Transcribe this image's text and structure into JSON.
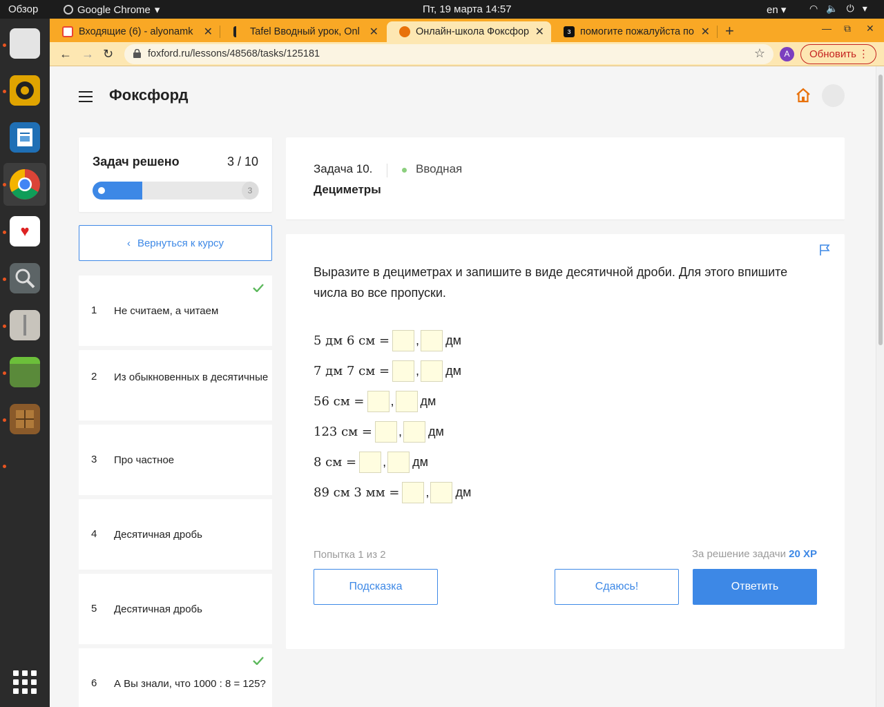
{
  "topbar": {
    "overview": "Обзор",
    "app_name": "Google Chrome",
    "clock": "Пт, 19 марта  14:57",
    "lang": "en"
  },
  "browser": {
    "tabs": [
      {
        "title": "Входящие (6) - alyonamk",
        "favicon_color": "#ea4335"
      },
      {
        "title": "Tafel Вводный урок, Onl",
        "favicon_color": "#222222"
      },
      {
        "title": "Онлайн-школа Фоксфор",
        "favicon_color": "#e8710a"
      },
      {
        "title": "помогите пожалуйста по",
        "favicon_color": "#111111"
      }
    ],
    "url": "foxford.ru/lessons/48568/tasks/125181",
    "profile_initial": "A",
    "update_label": "Обновить"
  },
  "page": {
    "logo": "Фоксфорд",
    "progress": {
      "label": "Задач решено",
      "count": "3 / 10",
      "fraction": 0.3,
      "end_number": "3"
    },
    "back_label": "Вернуться к курсу",
    "tasks": [
      {
        "num": "1",
        "title": "Не считаем, а читаем",
        "solved": true
      },
      {
        "num": "2",
        "title": "Из обыкновенных в десятичные",
        "solved": false
      },
      {
        "num": "3",
        "title": "Про частное",
        "solved": false
      },
      {
        "num": "4",
        "title": "Десятичная дробь",
        "solved": false
      },
      {
        "num": "5",
        "title": "Десятичная дробь",
        "solved": false
      },
      {
        "num": "6",
        "title": "А Вы знали, что 1000 : 8 = 125?",
        "solved": true
      }
    ],
    "task_header": {
      "number": "Задача 10.",
      "difficulty": "Вводная",
      "name": "Дециметры"
    },
    "question": "Выразите в дециметрах и запишите в виде десятичной дроби. Для этого впишите числа во все пропуски.",
    "equations": [
      {
        "lhs": "5 дм 6 см =",
        "unit": "дм"
      },
      {
        "lhs": "7 дм 7 см =",
        "unit": "дм"
      },
      {
        "lhs": "56 см =",
        "unit": "дм"
      },
      {
        "lhs": "123 см =",
        "unit": "дм"
      },
      {
        "lhs": "8 см =",
        "unit": "дм"
      },
      {
        "lhs": "89 см 3 мм =",
        "unit": "дм"
      }
    ],
    "comma": ",",
    "attempt": "Попытка 1 из 2",
    "reward_label": "За решение задачи",
    "reward_xp": "20 XP",
    "hint_label": "Подсказка",
    "giveup_label": "Сдаюсь!",
    "answer_label": "Ответить"
  },
  "colors": {
    "accent": "#3d88e6",
    "tabstrip": "#f9a825",
    "success": "#5cb85c",
    "home": "#e8710a"
  }
}
